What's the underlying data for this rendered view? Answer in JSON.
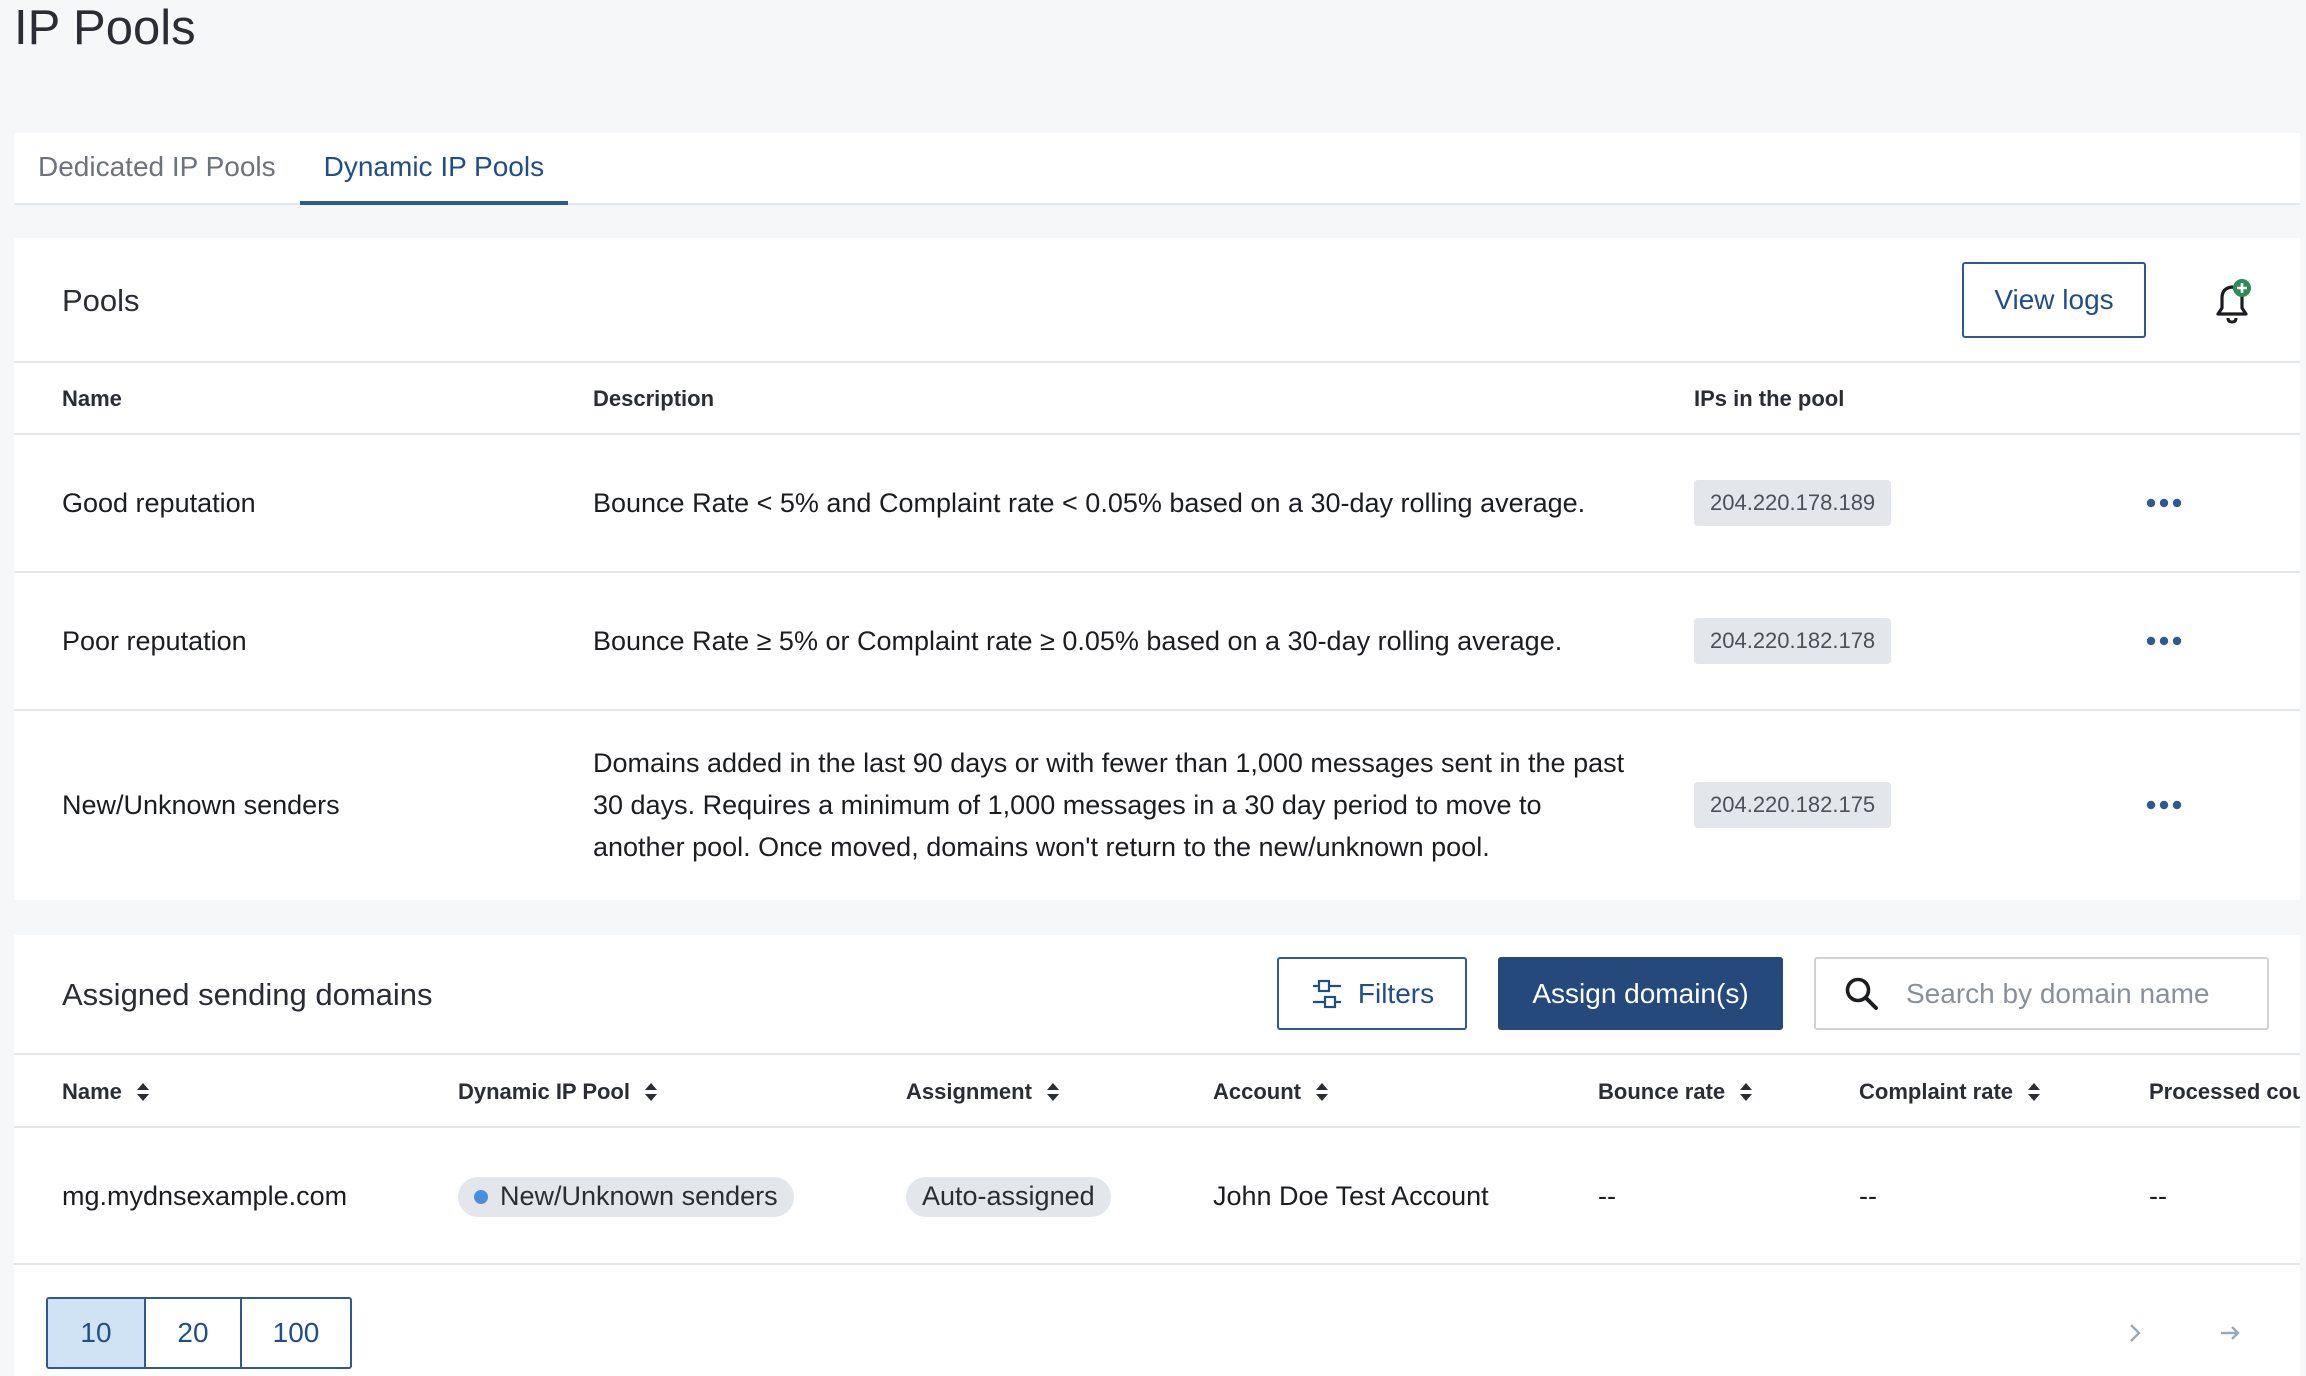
{
  "page": {
    "title": "IP Pools"
  },
  "tabs": [
    {
      "label": "Dedicated IP Pools",
      "active": false
    },
    {
      "label": "Dynamic IP Pools",
      "active": true
    }
  ],
  "pools": {
    "title": "Pools",
    "view_logs_label": "View logs",
    "columns": {
      "name": "Name",
      "description": "Description",
      "ips": "IPs in the pool"
    },
    "rows": [
      {
        "name": "Good reputation",
        "description": "Bounce Rate < 5% and Complaint rate < 0.05% based on a 30-day rolling average.",
        "ip": "204.220.178.189"
      },
      {
        "name": "Poor reputation",
        "description": "Bounce Rate ≥ 5% or Complaint rate ≥ 0.05% based on a 30-day rolling average.",
        "ip": "204.220.182.178"
      },
      {
        "name": "New/Unknown senders",
        "description": "Domains added in the last 90 days or with fewer than 1,000 messages sent in the past 30 days. Requires a minimum of 1,000 messages in a 30 day period to move to another pool. Once moved, domains won't return to the new/unknown pool.",
        "ip": "204.220.182.175"
      }
    ],
    "more_glyph": "•••"
  },
  "domains": {
    "title": "Assigned sending domains",
    "filters_label": "Filters",
    "assign_label": "Assign domain(s)",
    "search_placeholder": "Search by domain name",
    "columns": {
      "name": "Name",
      "pool": "Dynamic IP Pool",
      "assignment": "Assignment",
      "account": "Account",
      "bounce": "Bounce rate",
      "complaint": "Complaint rate",
      "processed": "Processed count"
    },
    "rows": [
      {
        "name": "mg.mydnsexample.com",
        "pool": "New/Unknown senders",
        "assignment": "Auto-assigned",
        "account": "John Doe Test Account",
        "bounce": "--",
        "complaint": "--",
        "processed": "--"
      }
    ],
    "page_sizes": [
      "10",
      "20",
      "100"
    ],
    "selected_page_size": "10"
  },
  "colors": {
    "accent": "#2d5a91",
    "primary_button": "#25497a",
    "badge_bg": "#e3e6ea",
    "bell_plus": "#2e8b57",
    "pool_dot": "#4a8fdc"
  },
  "icons": {
    "more": "more-horizontal-icon",
    "bell": "bell-plus-icon",
    "filters": "sliders-icon",
    "search": "search-icon",
    "sort": "sort-icon",
    "next": "chevron-right-icon",
    "last": "arrow-right-icon"
  }
}
